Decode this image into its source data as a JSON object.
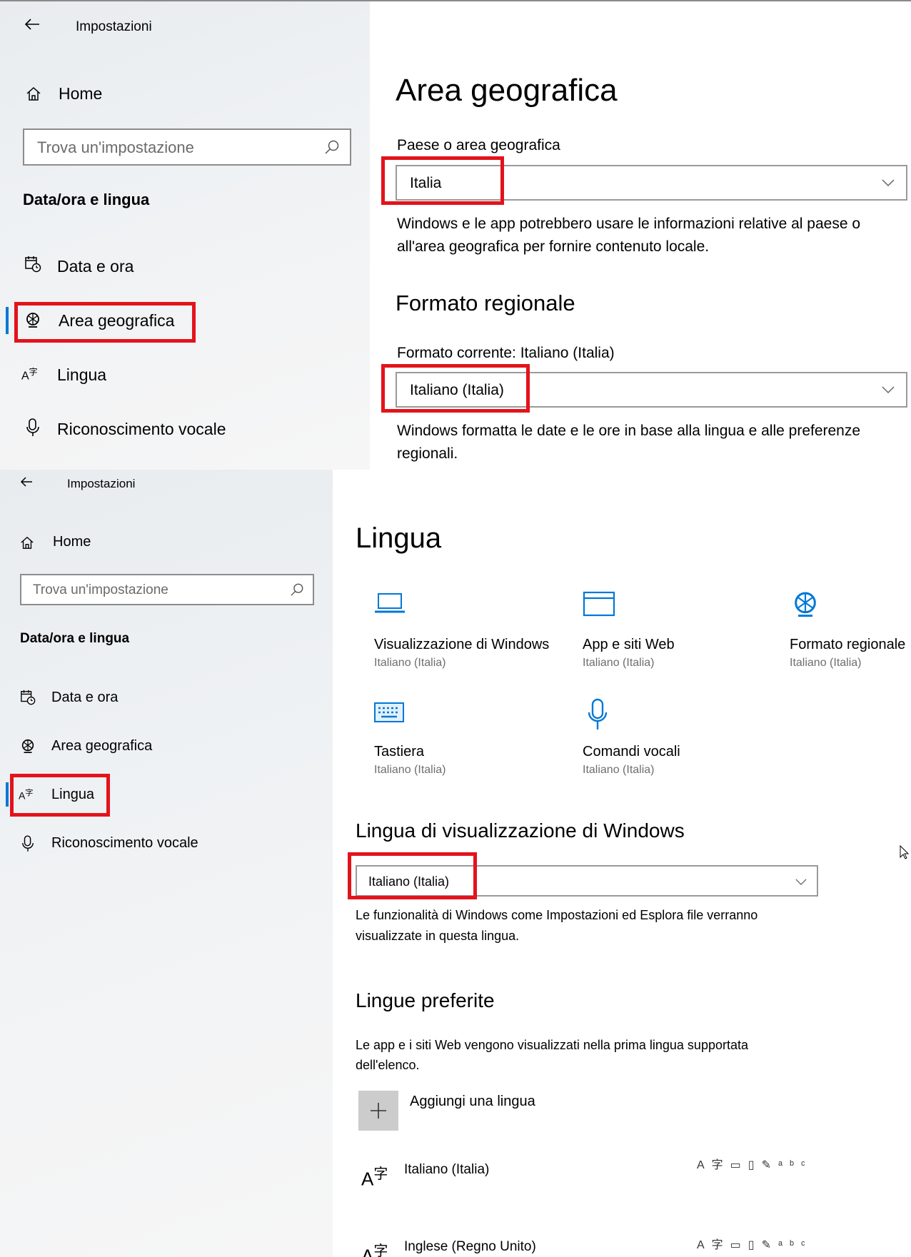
{
  "panel1": {
    "window_title": "Impostazioni",
    "home_label": "Home",
    "search_placeholder": "Trova un'impostazione",
    "section_title": "Data/ora e lingua",
    "nav": [
      {
        "label": "Data e ora",
        "icon": "calendar-clock-icon"
      },
      {
        "label": "Area geografica",
        "icon": "globe-icon",
        "selected": true
      },
      {
        "label": "Lingua",
        "icon": "language-icon"
      },
      {
        "label": "Riconoscimento vocale",
        "icon": "microphone-icon"
      }
    ],
    "page_title": "Area geografica",
    "country_label": "Paese o area geografica",
    "country_value": "Italia",
    "country_desc_1": "Windows e le app potrebbero usare le informazioni relative al paese o",
    "country_desc_2": "all'area geografica per fornire contenuto locale.",
    "format_heading": "Formato regionale",
    "format_current": "Formato corrente: Italiano (Italia)",
    "format_value": "Italiano (Italia)",
    "format_desc_1": "Windows formatta le date e le ore in base alla lingua e alle preferenze",
    "format_desc_2": "regionali."
  },
  "panel2": {
    "window_title": "Impostazioni",
    "home_label": "Home",
    "search_placeholder": "Trova un'impostazione",
    "section_title": "Data/ora e lingua",
    "nav": [
      {
        "label": "Data e ora",
        "icon": "calendar-clock-icon"
      },
      {
        "label": "Area geografica",
        "icon": "globe-icon"
      },
      {
        "label": "Lingua",
        "icon": "language-icon",
        "selected": true
      },
      {
        "label": "Riconoscimento vocale",
        "icon": "microphone-icon"
      }
    ],
    "page_title": "Lingua",
    "tiles": [
      {
        "title": "Visualizzazione di Windows",
        "sub": "Italiano (Italia)",
        "icon": "laptop-icon"
      },
      {
        "title": "App e siti Web",
        "sub": "Italiano (Italia)",
        "icon": "browser-window-icon"
      },
      {
        "title": "Formato regionale",
        "sub": "Italiano (Italia)",
        "icon": "globe-icon"
      },
      {
        "title": "Tastiera",
        "sub": "Italiano (Italia)",
        "icon": "keyboard-icon"
      },
      {
        "title": "Comandi vocali",
        "sub": "Italiano (Italia)",
        "icon": "microphone-icon"
      }
    ],
    "display_lang_heading": "Lingua di visualizzazione di Windows",
    "display_lang_value": "Italiano (Italia)",
    "display_lang_desc_1": "Le funzionalità di Windows come Impostazioni ed Esplora file verranno",
    "display_lang_desc_2": "visualizzate in questa lingua.",
    "preferred_heading": "Lingue preferite",
    "preferred_desc_1": "Le app e i siti Web vengono visualizzati nella prima lingua supportata",
    "preferred_desc_2": "dell'elenco.",
    "add_language_label": "Aggiungi una lingua",
    "languages": [
      {
        "name": "Italiano (Italia)"
      },
      {
        "name": "Inglese (Regno Unito)"
      }
    ]
  },
  "colors": {
    "accent": "#0078d7",
    "highlight": "#e3131b"
  }
}
